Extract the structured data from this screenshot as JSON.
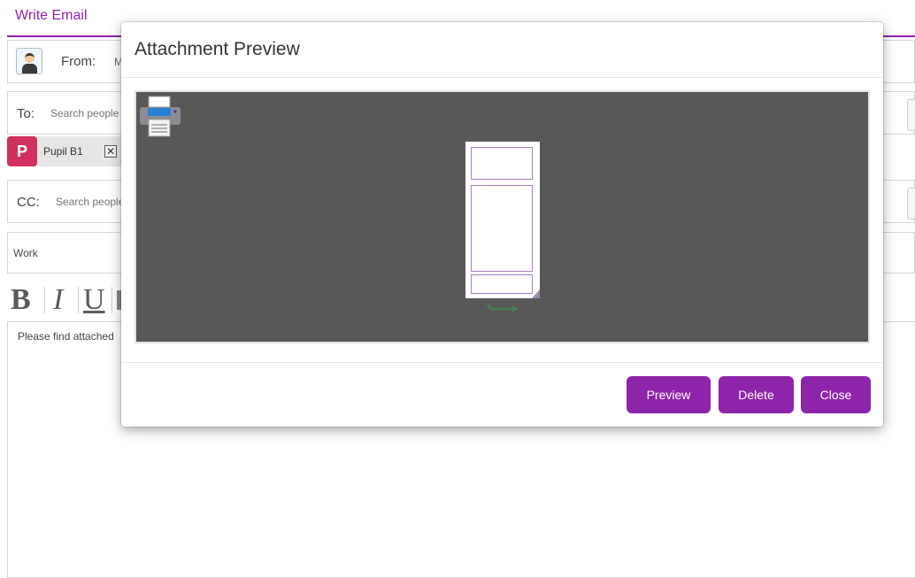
{
  "header": {
    "title": "Write Email"
  },
  "from": {
    "label": "From:",
    "value": "M"
  },
  "to": {
    "label": "To:",
    "placeholder": "Search people",
    "recipients": [
      {
        "initial": "P",
        "name": "Pupil B1",
        "remove": "✕"
      }
    ]
  },
  "cc": {
    "label": "CC:",
    "placeholder": "Search people"
  },
  "subject": {
    "value": "Work"
  },
  "toolbar": {
    "bold": "B",
    "italic": "I",
    "underline": "U"
  },
  "body": {
    "text": "Please find attached"
  },
  "modal": {
    "title": "Attachment Preview",
    "print_icon": "printer-icon",
    "buttons": {
      "preview": "Preview",
      "delete": "Delete",
      "close": "Close"
    }
  },
  "colors": {
    "accent": "#8e24aa",
    "viewer_bg": "#585858",
    "chip_avatar": "#d1315f"
  }
}
